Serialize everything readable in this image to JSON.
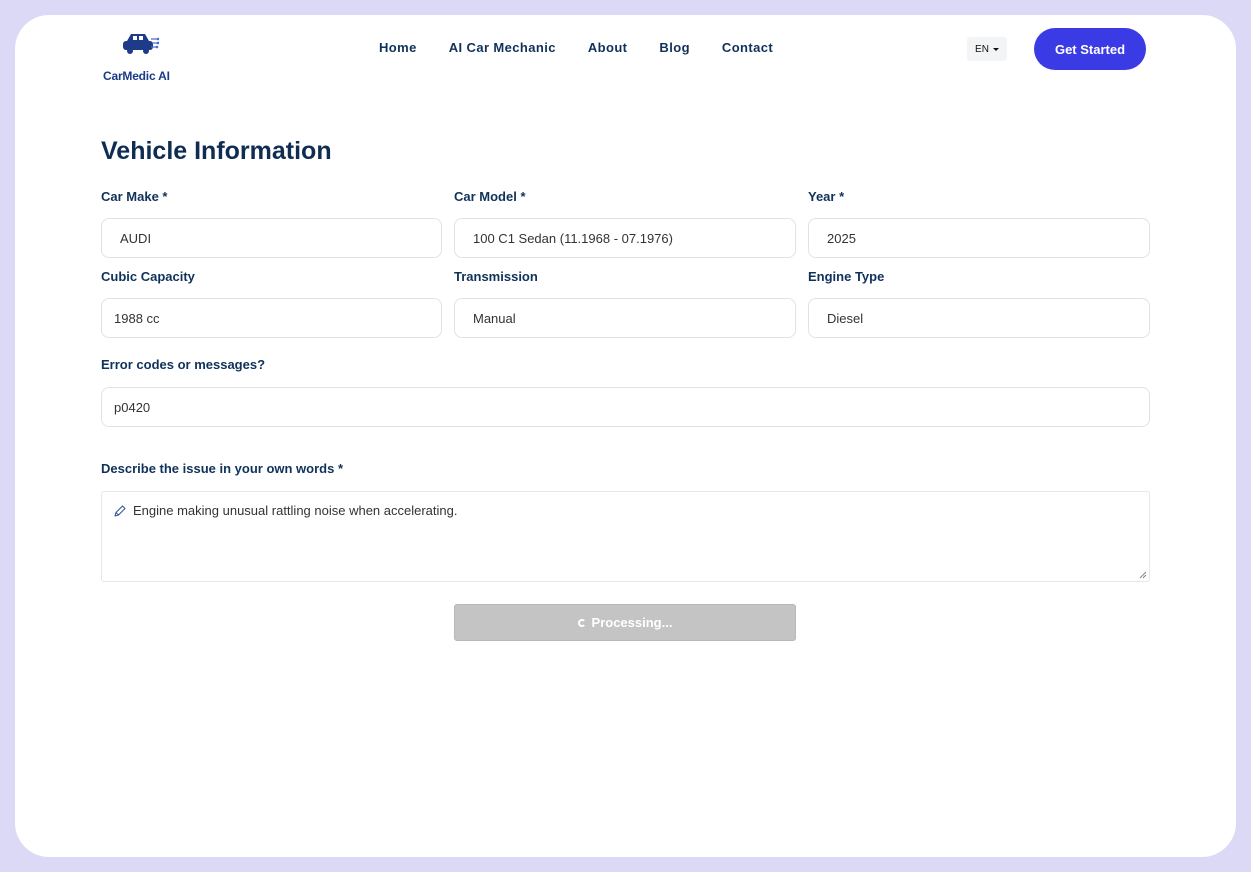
{
  "header": {
    "logo_text": "CarMedic AI",
    "nav": [
      "Home",
      "AI Car Mechanic",
      "About",
      "Blog",
      "Contact"
    ],
    "language": "EN",
    "cta_label": "Get Started"
  },
  "form": {
    "title": "Vehicle Information",
    "car_make": {
      "label": "Car Make *",
      "value": "AUDI"
    },
    "car_model": {
      "label": "Car Model *",
      "value": "100 C1 Sedan (11.1968 - 07.1976)"
    },
    "year": {
      "label": "Year *",
      "value": "2025"
    },
    "cubic_capacity": {
      "label": "Cubic Capacity",
      "value": "1988 cc"
    },
    "transmission": {
      "label": "Transmission",
      "value": "Manual"
    },
    "engine_type": {
      "label": "Engine Type",
      "value": "Diesel"
    },
    "error_codes": {
      "label": "Error codes or messages?",
      "value": "p0420"
    },
    "issue": {
      "label": "Describe the issue in your own words *",
      "value": "Engine making unusual rattling noise when accelerating."
    },
    "submit_label": "Processing..."
  },
  "colors": {
    "accent": "#3b3be6",
    "text": "#0f2d52",
    "frame": "#dcd9f7",
    "disabled": "#c4c4c4"
  },
  "icons": [
    "car-logo-icon",
    "chevron-down-icon",
    "pencil-icon",
    "spinner-icon",
    "resize-grip-icon"
  ]
}
